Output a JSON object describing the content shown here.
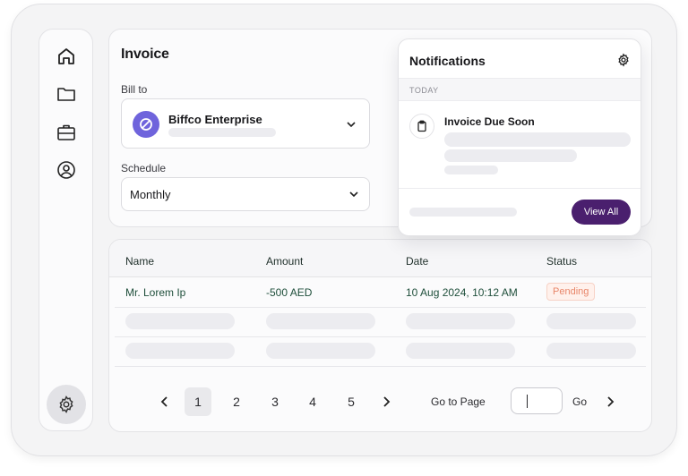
{
  "invoice": {
    "title": "Invoice",
    "bill_to_label": "Bill to",
    "bill_to_value": "Biffco Enterprise",
    "schedule_label": "Schedule",
    "schedule_value": "Monthly"
  },
  "table": {
    "headers": [
      "Name",
      "Amount",
      "Date",
      "Status"
    ],
    "rows": [
      {
        "name": "Mr. Lorem Ip",
        "amount": "-500 AED",
        "date": "10 Aug 2024, 10:12 AM",
        "status": "Pending"
      }
    ]
  },
  "pagination": {
    "pages": [
      "1",
      "2",
      "3",
      "4",
      "5"
    ],
    "current_page": "1",
    "goto_label": "Go to Page",
    "go_label": "Go"
  },
  "notifications": {
    "title": "Notifications",
    "section_label": "TODAY",
    "item_title": "Invoice Due Soon",
    "view_all_label": "View All"
  },
  "colors": {
    "accent_purple": "#4a1f6e",
    "avatar_purple": "#6f64dc",
    "pending_text": "#e8866a",
    "pending_bg": "#fff1ec",
    "table_text_green": "#1f4f3b"
  },
  "icons": {
    "sidebar": [
      "home-icon",
      "folder-icon",
      "briefcase-icon",
      "user-circle-icon"
    ],
    "sidebar_bottom": "gear-icon",
    "notification_settings": "gear-icon",
    "notification_item": "clipboard-icon"
  }
}
